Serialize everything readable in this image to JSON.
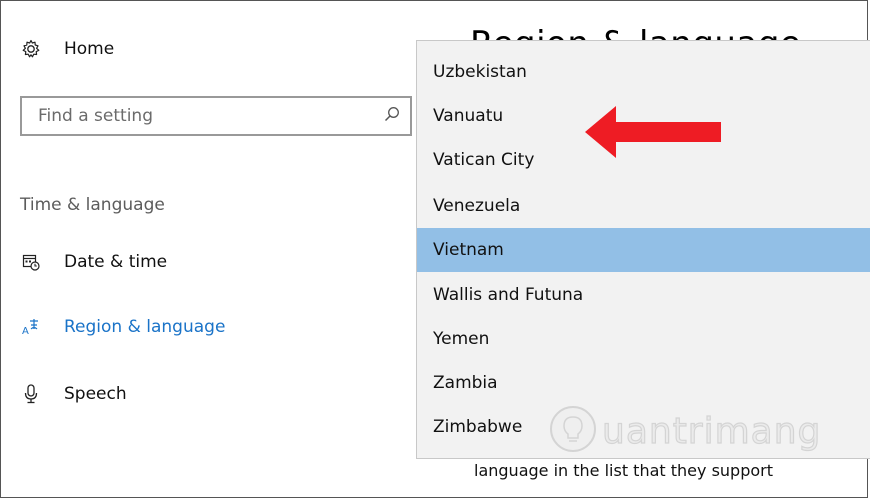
{
  "sidebar": {
    "home_label": "Home",
    "search_placeholder": "Find a setting",
    "section_label": "Time & language",
    "items": [
      {
        "label": "Date & time",
        "icon": "calendar-clock-icon"
      },
      {
        "label": "Region & language",
        "icon": "language-icon",
        "selected": true
      },
      {
        "label": "Speech",
        "icon": "microphone-icon"
      }
    ]
  },
  "page": {
    "title": "Region & language"
  },
  "dropdown": {
    "options": [
      "Uzbekistan",
      "Vanuatu",
      "Vatican City",
      "Venezuela",
      "Vietnam",
      "Wallis and Futuna",
      "Yemen",
      "Zambia",
      "Zimbabwe"
    ],
    "selected": "Vietnam"
  },
  "annotation": {
    "arrow_color": "#ee1c24",
    "points_to": "Vanuatu"
  },
  "watermark": {
    "text": "uantrimang"
  },
  "content": {
    "footer_text": "language in the list that they support"
  },
  "colors": {
    "accent": "#1a73c8",
    "selection": "#92bfe6",
    "dropdown_bg": "#f2f2f2"
  }
}
